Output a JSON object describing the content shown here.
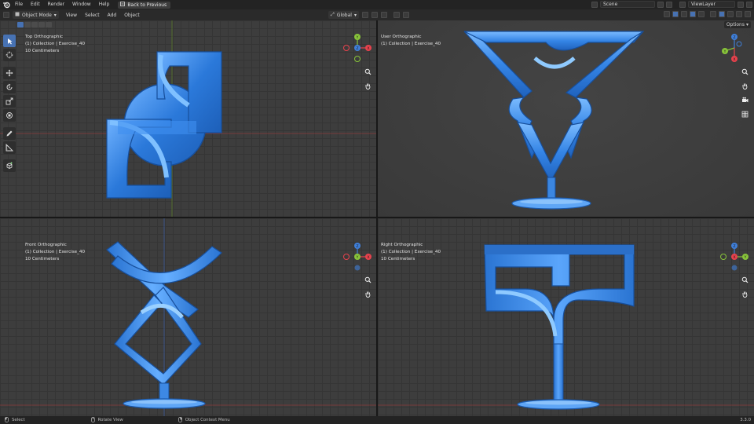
{
  "topbar": {
    "menus": [
      "File",
      "Edit",
      "Render",
      "Window",
      "Help"
    ],
    "back_label": "Back to Previous",
    "scene": "Scene",
    "view_layer": "ViewLayer"
  },
  "header": {
    "mode": "Object Mode",
    "menus": [
      "View",
      "Select",
      "Add",
      "Object"
    ],
    "transform_orientation": "Global",
    "options_label": "Options"
  },
  "viewports": {
    "top": {
      "title": "Top Orthographic",
      "collection": "(1) Collection | Exercise_40",
      "scale": "10 Centimeters"
    },
    "user": {
      "title": "User Orthographic",
      "collection": "(1) Collection | Exercise_40"
    },
    "front": {
      "title": "Front Orthographic",
      "collection": "(1) Collection | Exercise_40",
      "scale": "10 Centimeters"
    },
    "right": {
      "title": "Right Orthographic",
      "collection": "(1) Collection | Exercise_40",
      "scale": "10 Centimeters"
    }
  },
  "gizmo_axes": {
    "x": "X",
    "y": "Y",
    "z": "Z"
  },
  "colors": {
    "axis_x": "#e8424d",
    "axis_y": "#88c43a",
    "axis_z": "#3f7fd9",
    "model_blue": "#2e7fe0",
    "accent": "#4772b3"
  },
  "statusbar": {
    "select": "Select",
    "rotate": "Rotate View",
    "context": "Object Context Menu",
    "version": "3.3.0"
  },
  "icons": [
    "blender-logo-icon",
    "back-icon",
    "cursor-icon",
    "move-icon",
    "rotate-icon",
    "scale-icon",
    "transform-icon",
    "annotate-icon",
    "measure-icon",
    "add-cube-icon",
    "zoom-icon",
    "hand-icon",
    "camera-icon",
    "grid-icon"
  ]
}
